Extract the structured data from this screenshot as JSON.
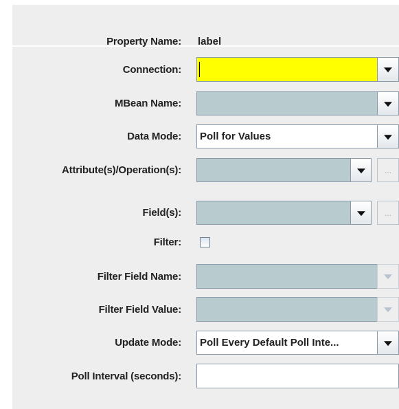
{
  "form": {
    "property_name": {
      "label": "Property Name:",
      "value": "label"
    },
    "connection": {
      "label": "Connection:",
      "value": ""
    },
    "mbean_name": {
      "label": "MBean Name:",
      "value": ""
    },
    "data_mode": {
      "label": "Data Mode:",
      "value": "Poll for Values"
    },
    "attributes_operations": {
      "label": "Attribute(s)/Operation(s):",
      "value": "",
      "browse_label": "..."
    },
    "fields": {
      "label": "Field(s):",
      "value": "",
      "browse_label": "..."
    },
    "filter": {
      "label": "Filter:",
      "checked": false
    },
    "filter_field_name": {
      "label": "Filter Field Name:",
      "value": ""
    },
    "filter_field_value": {
      "label": "Filter Field Value:",
      "value": ""
    },
    "update_mode": {
      "label": "Update Mode:",
      "value": "Poll Every Default Poll Inte..."
    },
    "poll_interval": {
      "label": "Poll Interval (seconds):",
      "value": ""
    }
  },
  "icons": {
    "dropdown": "chevron-down-icon",
    "browse": "ellipsis-icon"
  },
  "colors": {
    "panel_bg": "#eeeeee",
    "connection_field_bg": "#ffff00",
    "disabled_combo_bg": "#b8cbcf",
    "field_border": "#8a9aa9"
  }
}
